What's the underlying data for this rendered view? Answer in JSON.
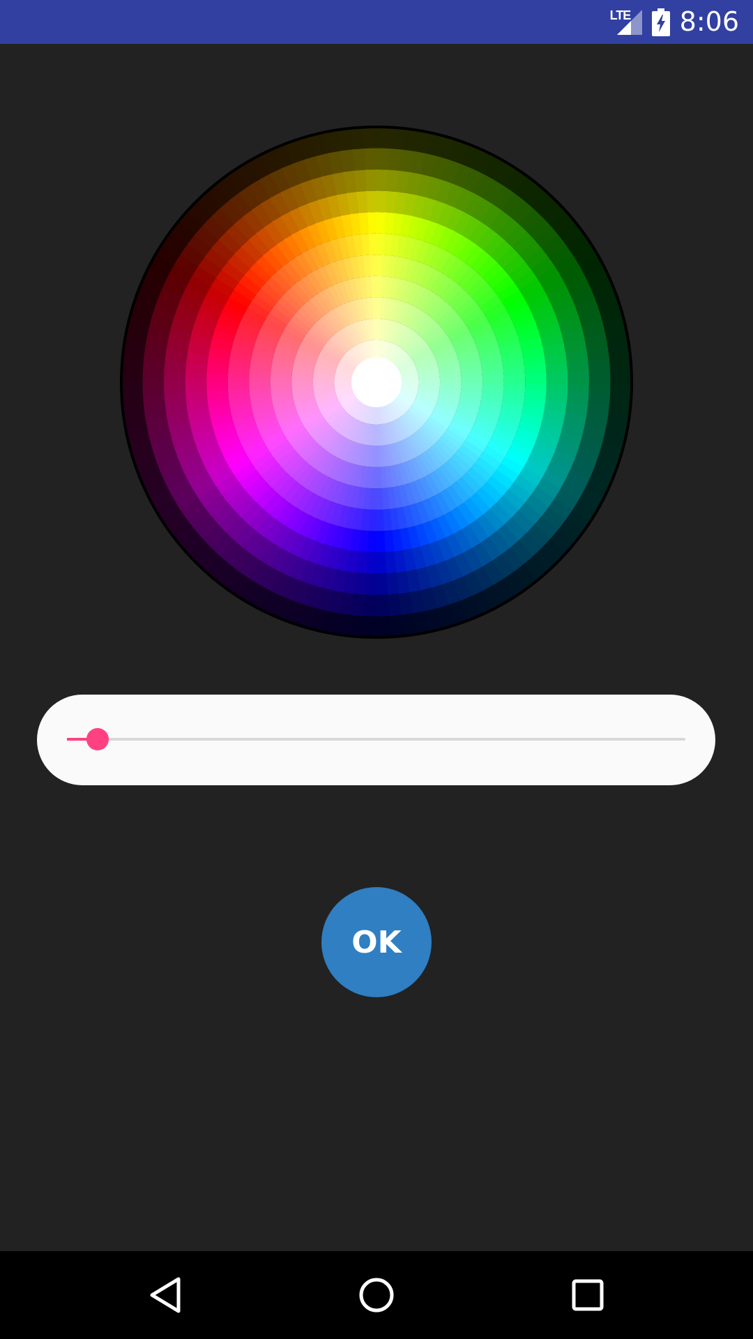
{
  "status_bar": {
    "network_label": "LTE",
    "time": "8:06",
    "icons": [
      "lte-signal-icon",
      "battery-charging-icon"
    ]
  },
  "color_wheel": {
    "hue_order": [
      "red",
      "yellow",
      "green",
      "cyan",
      "blue",
      "magenta"
    ],
    "ring_count": 11,
    "center_color": "#ffffff",
    "edge_color": "#000000"
  },
  "slider": {
    "value": 0.05,
    "track_color": "#d8d8d8",
    "accent_color": "#ff4081"
  },
  "ok_button": {
    "label": "OK",
    "color": "#2f7fc2"
  },
  "navigation": {
    "buttons": [
      "back-icon",
      "home-icon",
      "recents-icon"
    ]
  },
  "colors": {
    "background": "#222222",
    "status_bar": "#3140a1",
    "nav_bar": "#000000"
  }
}
